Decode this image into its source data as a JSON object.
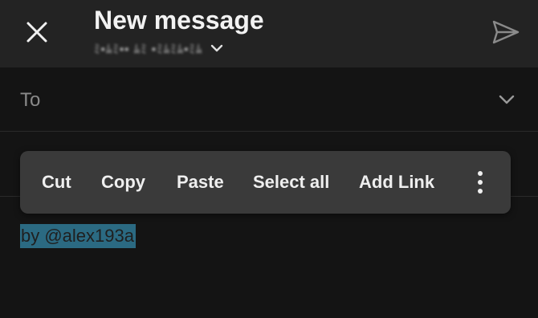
{
  "header": {
    "title": "New message",
    "account": "ﾐ▪ﾑﾐ▪▪ ﾑﾐ ▪ﾐﾑﾐﾑ▪ﾐﾑ",
    "icons": {
      "close": "close-icon",
      "send": "send-icon",
      "account_chevron": "chevron-down-icon"
    }
  },
  "to_field": {
    "label": "To",
    "value": "",
    "icon": "chevron-down-icon"
  },
  "context_menu": {
    "cut": "Cut",
    "copy": "Copy",
    "paste": "Paste",
    "select_all": "Select all",
    "add_link": "Add Link",
    "more_icon": "more-vertical-icon"
  },
  "body": {
    "selected_text": "by @alex193a"
  },
  "colors": {
    "background": "#141414",
    "topbar": "#232323",
    "menu": "#3a3a3a",
    "selection": "#2b6a82"
  }
}
